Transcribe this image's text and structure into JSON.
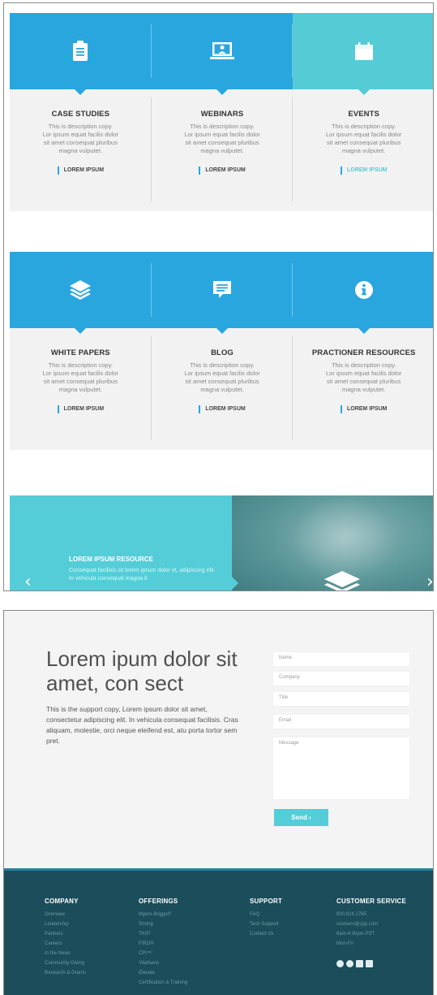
{
  "row1": [
    {
      "title": "CASE STUDIES",
      "icon": "clipboard-icon",
      "band_color": "#29a6de",
      "desc": [
        "This is description copy.",
        "Lor ipsum equat facilis dolor",
        "sit amet consequat pluribus",
        "magna vulputet."
      ],
      "link": "LOREM IPSUM"
    },
    {
      "title": "WEBINARS",
      "icon": "webinar-icon",
      "band_color": "#29a6de",
      "desc": [
        "This is description copy.",
        "Lor ipsum equat facilis dolor",
        "sit amet consequat pluribus",
        "magna vulputet."
      ],
      "link": "LOREM IPSUM"
    },
    {
      "title": "EVENTS",
      "icon": "calendar-icon",
      "band_color": "#55cbd6",
      "desc": [
        "This is description copy.",
        "Lor ipsum equat facilis dolor",
        "sit amet consequat pluribus",
        "magna vulputet."
      ],
      "link": "LOREM IPSUM"
    }
  ],
  "row2": [
    {
      "title": "WHITE PAPERS",
      "icon": "layers-icon",
      "band_color": "#29a6de",
      "desc": [
        "This is description copy.",
        "Lor ipsum equat facilis dolor",
        "sit amet consequat pluribus",
        "magna vulputet."
      ],
      "link": "LOREM IPSUM"
    },
    {
      "title": "BLOG",
      "icon": "chat-icon",
      "band_color": "#29a6de",
      "desc": [
        "This is description copy.",
        "Lor ipsum equat facilis dolor",
        "sit amet consequat pluribus",
        "magna vulputet."
      ],
      "link": "LOREM IPSUM"
    },
    {
      "title": "PRACTIONER RESOURCES",
      "icon": "info-icon",
      "band_color": "#29a6de",
      "desc": [
        "This is description copy.",
        "Lor ipsum equat facilis dolor",
        "sit amet consequat pluribus",
        "magna vulputet."
      ],
      "link": "LOREM IPSUM"
    }
  ],
  "carousel": {
    "title": "LOREM IPSUM RESOURCE",
    "desc": "Consequat facilisis sit lorem ipsum dolor et, adipiscing elit. In vehicula consequat magna ll",
    "prev": "‹",
    "next": "›",
    "icon": "layers-icon"
  },
  "contact": {
    "title": "Lorem ipum dolor sit amet, con sect",
    "copy": "This is the support copy, Lorem ipsum dolor sit amet, consectetur adipiscing elit. In vehicula consequat facilisis. Cras aliquam, molestie, orci neque eleifend est, atu porta tortor sem pret.",
    "fields": {
      "name": "Name",
      "company": "Company",
      "title": "Title",
      "email": "Email",
      "message": "Message"
    },
    "send": "Send ›"
  },
  "footer": {
    "company": {
      "heading": "COMPANY",
      "items": [
        "Overview",
        "Leadership",
        "Partners",
        "Careers",
        "In the News",
        "Community Giving",
        "Research & Grants"
      ]
    },
    "offerings": {
      "heading": "OFFERINGS",
      "items": [
        "Myers-Briggs®",
        "Strong",
        "TKI®",
        "FIRO®",
        "CPI™",
        "VitaNavis",
        "Elevate",
        "Certification & Training"
      ]
    },
    "support": {
      "heading": "SUPPORT",
      "items": [
        "FAQ",
        "Tech Support",
        "Contact Us"
      ]
    },
    "customer_service": {
      "heading": "CUSTOMER SERVICE",
      "items": [
        "800.624.1765",
        "custserv@cpp.com",
        "6am-4:30pm PST",
        "Mon-Fri"
      ]
    },
    "social": [
      "facebook-icon",
      "twitter-icon",
      "linkedin-icon",
      "youtube-icon"
    ]
  },
  "colors": {
    "blue": "#29a6de",
    "teal": "#55cbd6",
    "footer": "#1b4d5a"
  }
}
